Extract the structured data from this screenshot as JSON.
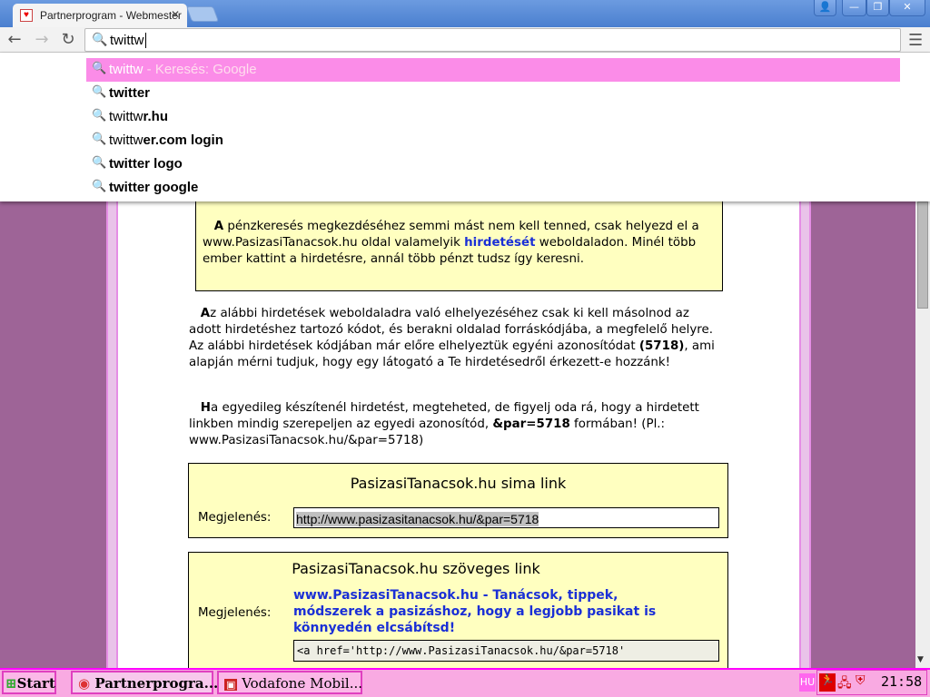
{
  "browser": {
    "tab_title": "Partnerprogram - Webmester",
    "omnibox_value": "twittw"
  },
  "suggestions": [
    {
      "typed": "twittw",
      "rest": " - Keresés: Google",
      "selected": true
    },
    {
      "typed": "twitter",
      "rest": ""
    },
    {
      "typed": "twittw",
      "rest": "r.hu"
    },
    {
      "typed": "twittw",
      "rest": "er.com login"
    },
    {
      "typed": "twitter logo",
      "rest": ""
    },
    {
      "typed": "twitter google",
      "rest": ""
    }
  ],
  "page": {
    "box_intro": {
      "lead": "A",
      "text1": " pénzkeresés megkezdéséhez semmi mást nem kell tenned, csak helyezd el a www.PasizasiTanacsok.hu oldal valamelyik ",
      "link": "hirdetését",
      "text2": " weboldaladon. Minél több ember kattint a hirdetésre, annál több pénzt tudsz így keresni."
    },
    "para1": {
      "lead": "A",
      "text1": "z alábbi hirdetések weboldaladra való elhelyezéséhez csak ki kell másolnod az adott hirdetéshez tartozó kódot, és berakni oldalad forráskódjába, a megfelelő helyre. Az alábbi hirdetések kódjában már előre elhelyeztük egyéni azonosítódat ",
      "id": "(5718)",
      "text2": ", ami alapján mérni tudjuk, hogy egy látogató a Te hirdetésedről érkezett-e hozzánk!"
    },
    "para2": {
      "lead": "H",
      "text1": "a egyedileg készítenél hirdetést, megteheted, de figyelj oda rá, hogy a hirdetett linkben mindig szerepeljen az egyedi azonosítód, ",
      "par": "&par=5718",
      "text2": " formában! (Pl.: www.PasizasiTanacsok.hu/&par=5718)"
    },
    "ad1": {
      "title": "PasizasiTanacsok.hu sima link",
      "label": "Megjelenés:",
      "value": "http://www.pasizasitanacsok.hu/&par=5718"
    },
    "ad2": {
      "title": "PasizasiTanacsok.hu szöveges link",
      "label": "Megjelenés:",
      "link": "www.PasizasiTanacsok.hu - Tanácsok, tippek, módszerek a pasizáshoz, hogy a legjobb pasikat is könnyedén elcsábítsd!",
      "code": "<a href='http://www.PasizasiTanacsok.hu/&par=5718'"
    }
  },
  "taskbar": {
    "start": "Start",
    "items": [
      "Partnerprogra...",
      "Vodafone Mobil..."
    ],
    "lang": "HU",
    "clock": "21:58"
  },
  "colors": {
    "highlight": "#fb8ce8",
    "side": "#9e6497",
    "box": "#ffffc0",
    "link": "#1a2fd6",
    "taskbar": "#f9aae2"
  }
}
